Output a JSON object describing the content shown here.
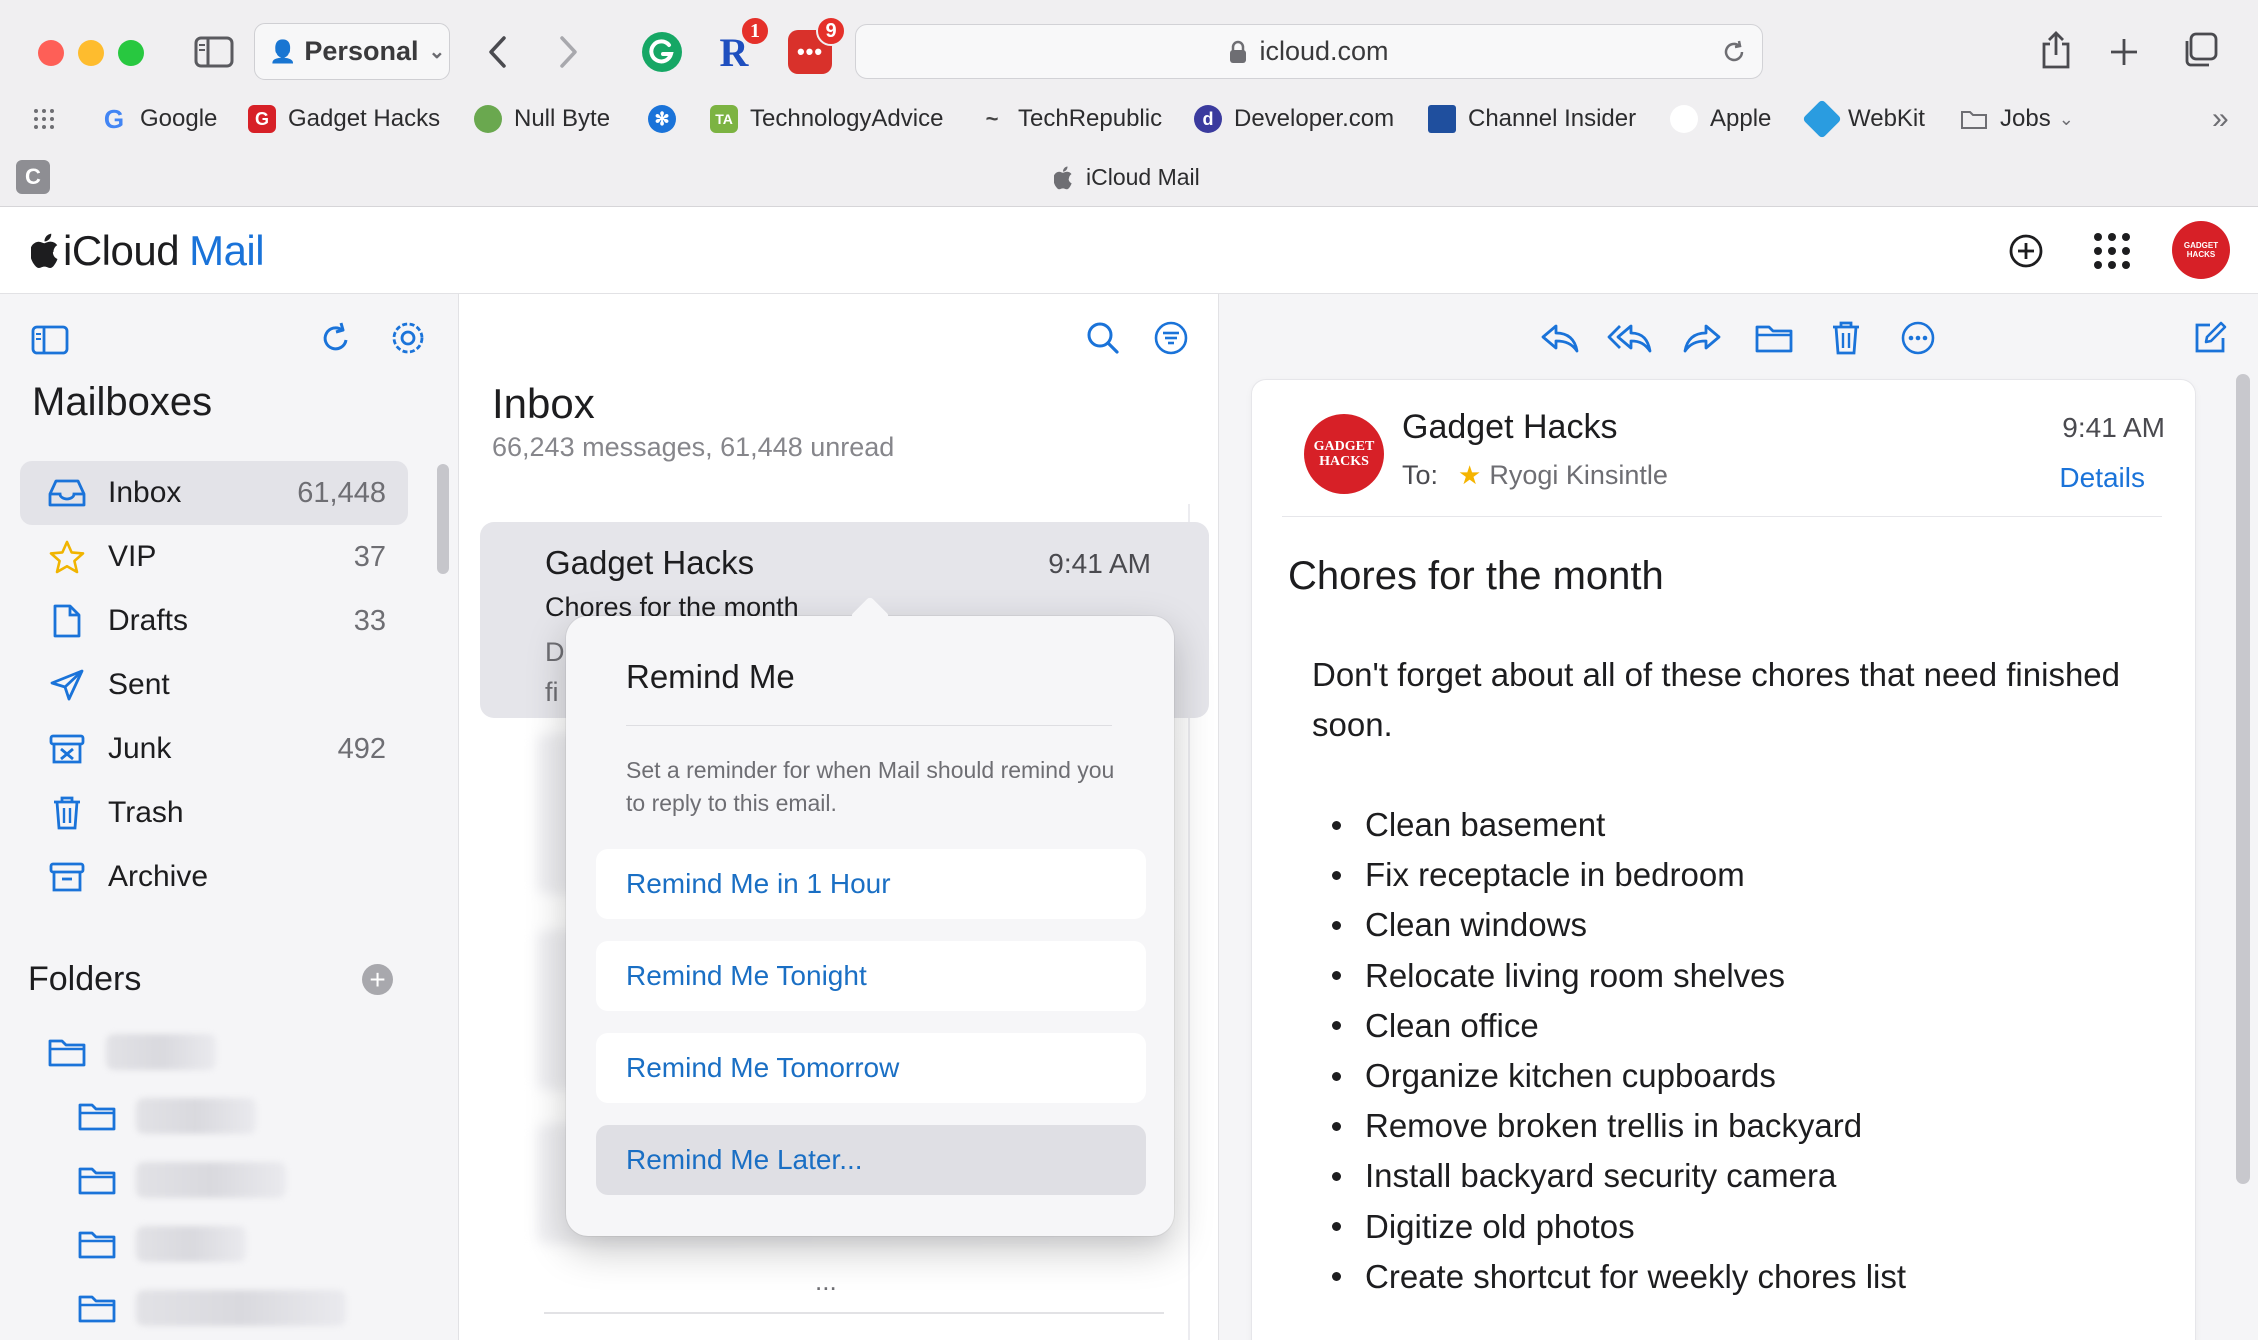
{
  "browser": {
    "profile": "Personal",
    "url": "icloud.com",
    "extensions": [
      {
        "name": "grammarly-icon",
        "color": "#16a765"
      },
      {
        "name": "r-extension-icon",
        "badge": "1",
        "color": "#1f4fbf"
      },
      {
        "name": "dots-extension-icon",
        "badge": "9",
        "color": "#d9312b"
      }
    ],
    "bookmarks": [
      {
        "label": "Google",
        "icon": "google-icon",
        "color": "#4285f4"
      },
      {
        "label": "Gadget Hacks",
        "icon": "gadget-hacks-icon",
        "color": "#d72027"
      },
      {
        "label": "Null Byte",
        "icon": "null-byte-icon",
        "color": "#6aa84f"
      },
      {
        "label": "",
        "icon": "globe-icon",
        "color": "#1a73d9"
      },
      {
        "label": "TechnologyAdvice",
        "icon": "technologyadvice-icon",
        "color": "#7cb342"
      },
      {
        "label": "TechRepublic",
        "icon": "techrepublic-icon",
        "color": "#444"
      },
      {
        "label": "Developer.com",
        "icon": "developer-com-icon",
        "color": "#3b3b9e"
      },
      {
        "label": "Channel Insider",
        "icon": "channel-insider-icon",
        "color": "#1f4f9e"
      },
      {
        "label": "Apple",
        "icon": "apple-icon",
        "color": "#1d1d1f"
      },
      {
        "label": "WebKit",
        "icon": "webkit-icon",
        "color": "#2a9ce0"
      },
      {
        "label": "Jobs",
        "icon": "folder-icon",
        "color": "#6e6e73"
      }
    ],
    "tab": {
      "letter": "C",
      "title": "iCloud Mail"
    }
  },
  "app": {
    "brand_main": "iCloud",
    "brand_accent": "Mail",
    "avatar_text": "GADGET HACKS",
    "accent_color": "#1a73d9"
  },
  "sidebar": {
    "title": "Mailboxes",
    "mailboxes": [
      {
        "label": "Inbox",
        "count": "61,448",
        "icon": "inbox-icon"
      },
      {
        "label": "VIP",
        "count": "37",
        "icon": "star-icon"
      },
      {
        "label": "Drafts",
        "count": "33",
        "icon": "drafts-icon"
      },
      {
        "label": "Sent",
        "count": "",
        "icon": "paper-plane-icon"
      },
      {
        "label": "Junk",
        "count": "492",
        "icon": "junk-icon"
      },
      {
        "label": "Trash",
        "count": "",
        "icon": "trash-icon"
      },
      {
        "label": "Archive",
        "count": "",
        "icon": "archive-icon"
      }
    ],
    "folders_title": "Folders"
  },
  "list": {
    "title": "Inbox",
    "summary": "66,243 messages, 61,448 unread",
    "selected": {
      "from": "Gadget Hacks",
      "time": "9:41 AM",
      "subject": "Chores for the month",
      "preview_line1": "D",
      "preview_line2": "fi"
    },
    "more": "..."
  },
  "remind_popover": {
    "title": "Remind Me",
    "description": "Set a reminder for when Mail should remind you to reply to this email.",
    "options": [
      "Remind Me in 1 Hour",
      "Remind Me Tonight",
      "Remind Me Tomorrow",
      "Remind Me Later..."
    ]
  },
  "reader": {
    "from": "Gadget Hacks",
    "time": "9:41 AM",
    "to_label": "To:",
    "to_name": "Ryogi Kinsintle",
    "details": "Details",
    "avatar_text": "GADGET HACKS",
    "subject": "Chores for the month",
    "body": "Don't forget about all of these chores that need finished soon.",
    "chores": [
      "Clean basement",
      "Fix receptacle in bedroom",
      "Clean windows",
      "Relocate living room shelves",
      "Clean office",
      "Organize kitchen cupboards",
      "Remove broken trellis in backyard",
      "Install backyard security camera",
      "Digitize old photos",
      "Create shortcut for weekly chores list"
    ]
  }
}
